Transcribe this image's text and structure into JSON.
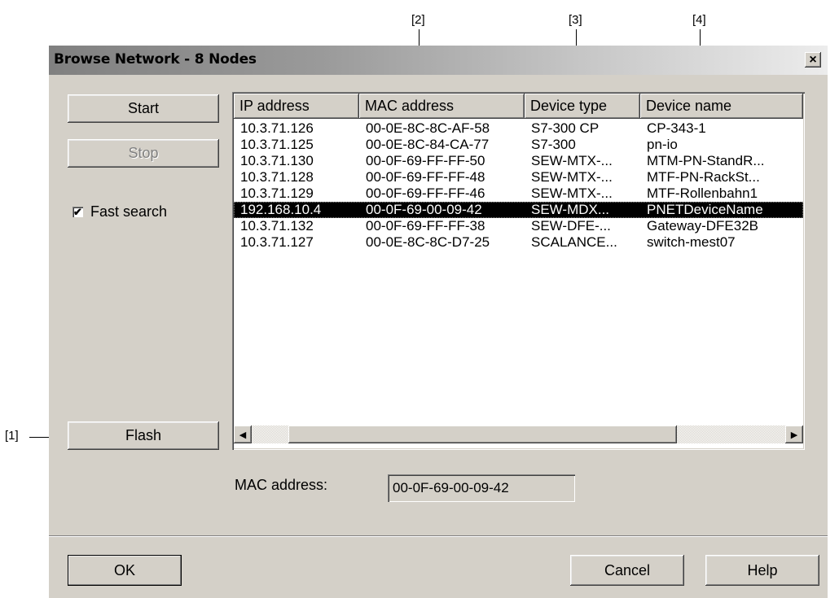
{
  "callouts": {
    "c1": "[1]",
    "c2": "[2]",
    "c3": "[3]",
    "c4": "[4]"
  },
  "dialog": {
    "title": "Browse Network - 8 Nodes",
    "close_label": "×"
  },
  "left_panel": {
    "start_label": "Start",
    "stop_label": "Stop",
    "fast_search_label": "Fast search",
    "fast_search_checked": true,
    "flash_label": "Flash"
  },
  "list": {
    "columns": [
      "IP address",
      "MAC address",
      "Device type",
      "Device name"
    ],
    "rows": [
      [
        "10.3.71.126",
        "00-0E-8C-8C-AF-58",
        "S7-300 CP",
        "CP-343-1"
      ],
      [
        "10.3.71.125",
        "00-0E-8C-84-CA-77",
        "S7-300",
        "pn-io"
      ],
      [
        "10.3.71.130",
        "00-0F-69-FF-FF-50",
        "SEW-MTX-...",
        "MTM-PN-StandR..."
      ],
      [
        "10.3.71.128",
        "00-0F-69-FF-FF-48",
        "SEW-MTX-...",
        "MTF-PN-RackSt..."
      ],
      [
        "10.3.71.129",
        "00-0F-69-FF-FF-46",
        "SEW-MTX-...",
        "MTF-Rollenbahn1"
      ],
      [
        "192.168.10.4",
        "00-0F-69-00-09-42",
        "SEW-MDX...",
        "PNETDeviceName"
      ],
      [
        "10.3.71.132",
        "00-0F-69-FF-FF-38",
        "SEW-DFE-...",
        "Gateway-DFE32B"
      ],
      [
        "10.3.71.127",
        "00-0E-8C-8C-D7-25",
        "SCALANCE...",
        "switch-mest07"
      ]
    ],
    "selected_index": 5
  },
  "mac": {
    "label": "MAC address:",
    "value": "00-0F-69-00-09-42"
  },
  "footer": {
    "ok_label": "OK",
    "cancel_label": "Cancel",
    "help_label": "Help"
  }
}
